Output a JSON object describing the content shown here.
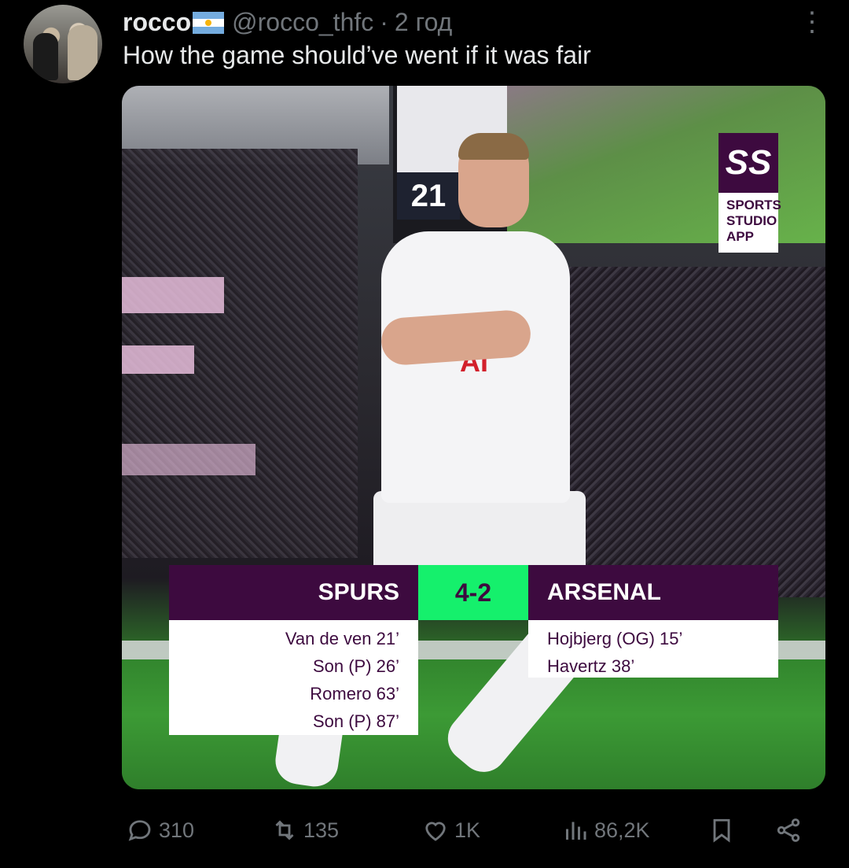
{
  "post": {
    "author_name": "rocco",
    "author_handle": "@rocco_thfc",
    "separator": "·",
    "time": "2 год",
    "text": "How the game should’ve went if it was fair"
  },
  "media": {
    "scoreboard_time": "21",
    "brand": {
      "mark": "SS",
      "line1": "SPORTS",
      "line2": "STUDIO",
      "line3": "APP",
      "color": "#3d0a3f"
    },
    "sponsor_text": "AI",
    "match": {
      "home_team": "SPURS",
      "score": "4-2",
      "away_team": "ARSENAL",
      "score_color": "#15f06c",
      "home_scorers": [
        "Van de ven 21’",
        "Son (P) 26’",
        "Romero 63’",
        "Son (P) 87’"
      ],
      "away_scorers": [
        "Hojbjerg (OG) 15’",
        "Havertz 38’"
      ]
    }
  },
  "actions": {
    "replies": "310",
    "reposts": "135",
    "likes": "1K",
    "views": "86,2K"
  },
  "icons": [
    "reply-icon",
    "repost-icon",
    "like-icon",
    "views-icon",
    "bookmark-icon",
    "share-icon",
    "more-icon"
  ]
}
